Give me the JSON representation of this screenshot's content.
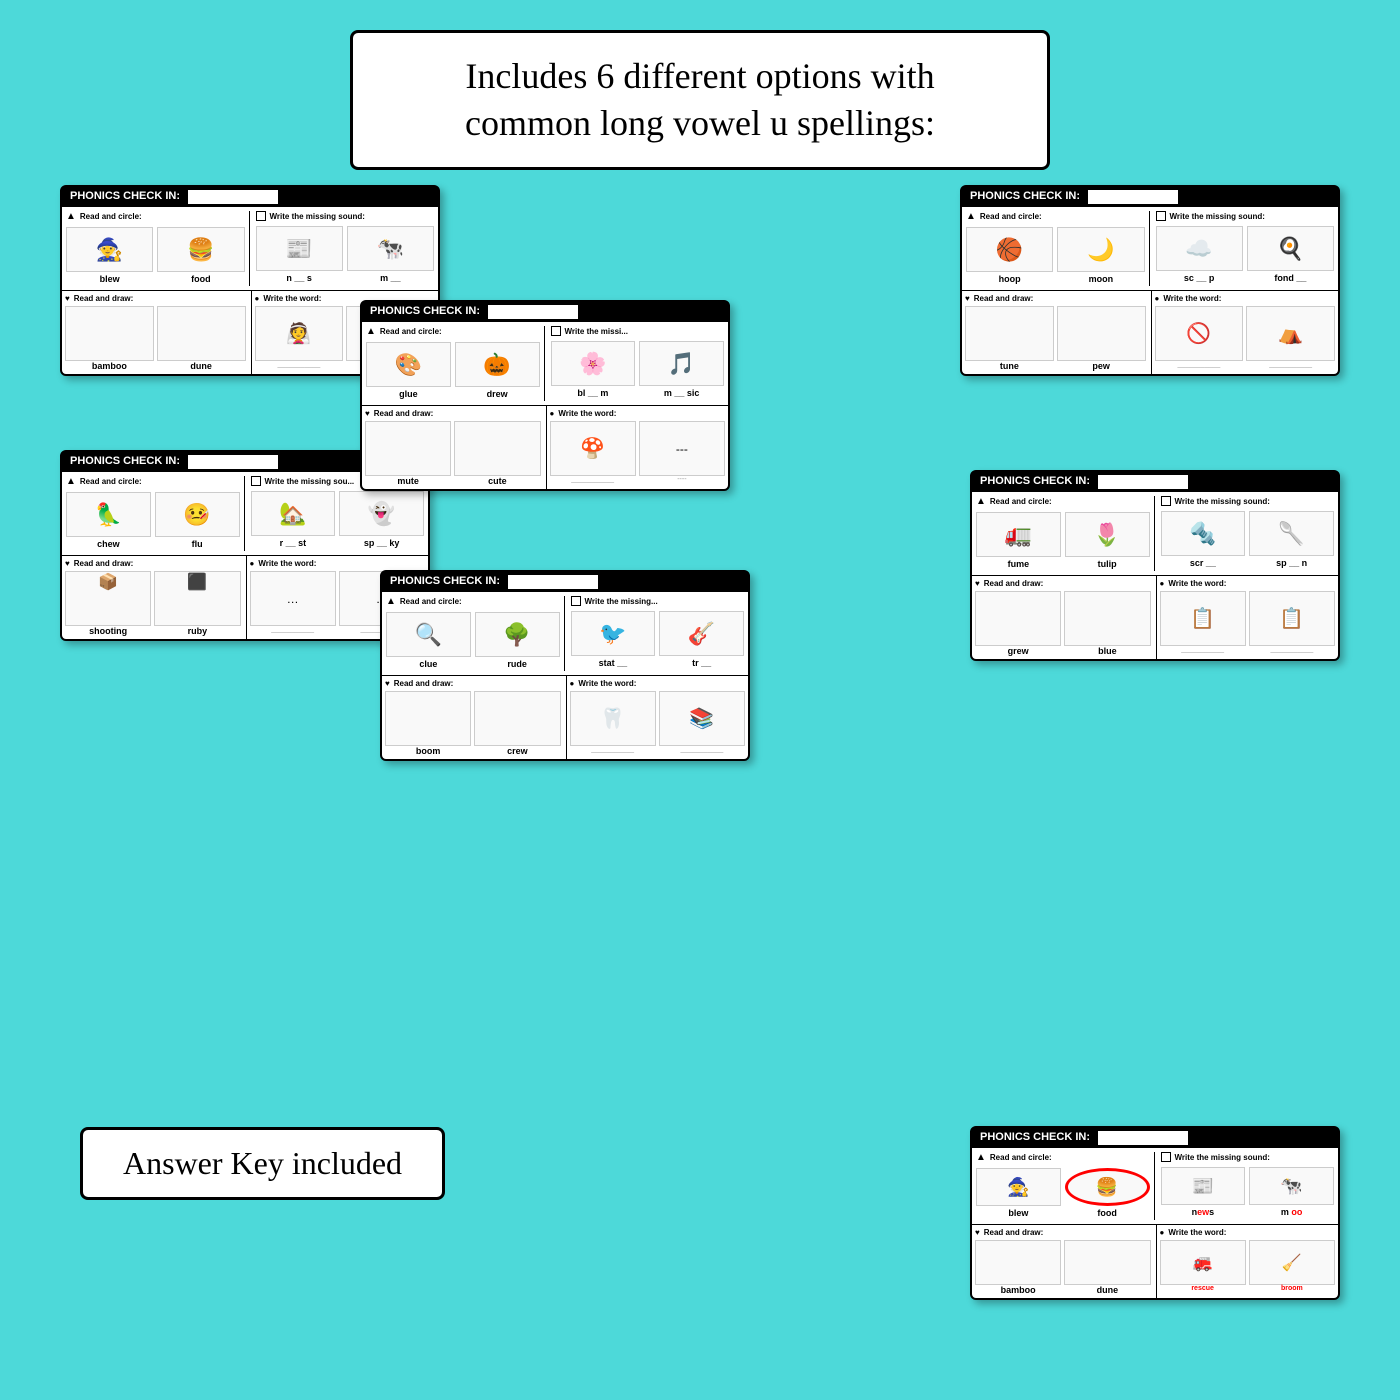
{
  "title": {
    "line1": "Includes 6 different options with",
    "line2": "common long vowel u spellings:"
  },
  "answer_key_label": "Answer Key included",
  "cards": [
    {
      "id": "card1",
      "header": "PHONICS CHECK IN:",
      "read_circle_label": "Read and circle:",
      "write_missing_label": "Write the missing sound:",
      "images": [
        {
          "emoji": "🧙",
          "label": "blew"
        },
        {
          "emoji": "🍔",
          "label": "food"
        },
        {
          "emoji": "📰",
          "label": "n __ s"
        },
        {
          "emoji": "🐄",
          "label": "m __"
        }
      ],
      "read_draw_label": "Read and draw:",
      "write_word_label": "Write the word:",
      "draw_words": [
        "bamboo",
        "dune"
      ],
      "write_words": [
        "___________",
        "___________"
      ]
    },
    {
      "id": "card2",
      "header": "PHONICS CHECK IN:",
      "read_circle_label": "Read and circle:",
      "write_missing_label": "Write the missing sound:",
      "images": [
        {
          "emoji": "🏀",
          "label": "hoop"
        },
        {
          "emoji": "🌙",
          "label": "moon"
        },
        {
          "emoji": "☁️",
          "label": "sc __ p"
        },
        {
          "emoji": "🍳",
          "label": "fond __"
        }
      ],
      "read_draw_label": "Read and draw:",
      "write_word_label": "Write the word:",
      "draw_words": [
        "tune",
        "pew"
      ],
      "write_words": [
        "___________",
        "___________"
      ]
    },
    {
      "id": "card3",
      "header": "PHONICS CHECK IN:",
      "read_circle_label": "Read and circle:",
      "write_missing_label": "Write the missing sound:",
      "images": [
        {
          "emoji": "🎨",
          "label": "glue"
        },
        {
          "emoji": "🎃",
          "label": "drew"
        },
        {
          "emoji": "🌸",
          "label": "bl __ m"
        },
        {
          "emoji": "🎵",
          "label": "m __ sic"
        }
      ],
      "read_draw_label": "Read and draw:",
      "write_word_label": "Write the word:",
      "draw_words": [
        "mute",
        "cute"
      ],
      "write_words": [
        "___________",
        "----"
      ]
    },
    {
      "id": "card4",
      "header": "PHONICS CHECK IN:",
      "read_circle_label": "Read and circle:",
      "write_missing_label": "Write the missing sound:",
      "images": [
        {
          "emoji": "🦜",
          "label": "chew"
        },
        {
          "emoji": "🤒",
          "label": "flu"
        },
        {
          "emoji": "🏡",
          "label": "r __ st"
        },
        {
          "emoji": "👻",
          "label": "sp __ ky"
        }
      ],
      "read_draw_label": "Read and draw:",
      "write_word_label": "Write the word:",
      "draw_words": [
        "shooting",
        "ruby"
      ],
      "write_words": [
        "___________",
        "___________"
      ]
    },
    {
      "id": "card5",
      "header": "PHONICS CHECK IN:",
      "read_circle_label": "Read and circle:",
      "write_missing_label": "Write the missing sound:",
      "images": [
        {
          "emoji": "🚛",
          "label": "fume"
        },
        {
          "emoji": "🌷",
          "label": "tulip"
        },
        {
          "emoji": "🔩",
          "label": "scr __"
        },
        {
          "emoji": "🥄",
          "label": "sp __ n"
        }
      ],
      "read_draw_label": "Read and draw:",
      "write_word_label": "Write the word:",
      "draw_words": [
        "grew",
        "blue"
      ],
      "write_words": [
        "___________",
        "___________"
      ]
    },
    {
      "id": "card6",
      "header": "PHONICS CHECK IN:",
      "read_circle_label": "Read and circle:",
      "write_missing_label": "Write the missing sound:",
      "images": [
        {
          "emoji": "🔍",
          "label": "clue"
        },
        {
          "emoji": "🌳",
          "label": "rude"
        },
        {
          "emoji": "🐦",
          "label": "stat __"
        },
        {
          "emoji": "🎸",
          "label": "tr __"
        }
      ],
      "read_draw_label": "Read and draw:",
      "write_word_label": "Write the word:",
      "draw_words": [
        "boom",
        "crew"
      ],
      "write_words": [
        "___________",
        "___________"
      ]
    },
    {
      "id": "card-answer",
      "header": "PHONICS CHECK IN:",
      "read_circle_label": "Read and circle:",
      "write_missing_label": "Write the missing sound:",
      "images": [
        {
          "emoji": "🧙",
          "label": "blew",
          "circled": false
        },
        {
          "emoji": "🍔",
          "label": "food",
          "circled": true
        },
        {
          "emoji": "📰",
          "label": "news",
          "answer": true,
          "answer_text": "n",
          "answer_highlight": "ew",
          "answer_end": "s"
        },
        {
          "emoji": "🐄",
          "label": "m oo",
          "answer": true,
          "answer_oo": true
        }
      ],
      "read_draw_label": "Read and draw:",
      "write_word_label": "Write the word:",
      "draw_words": [
        "bamboo",
        "dune"
      ],
      "write_words": [
        "rescue",
        "broom"
      ],
      "write_words_red": [
        true,
        true
      ]
    }
  ]
}
